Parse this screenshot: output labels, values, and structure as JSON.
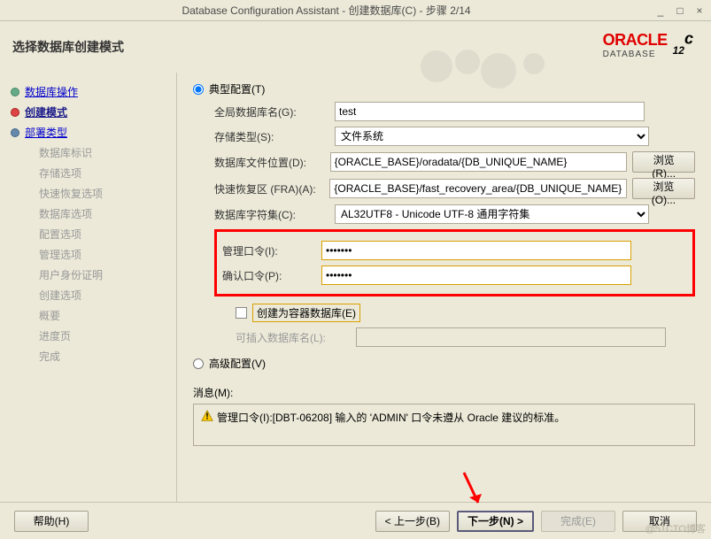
{
  "window": {
    "title": "Database Configuration Assistant - 创建数据库(C) - 步骤 2/14"
  },
  "header": {
    "title": "选择数据库创建模式",
    "brand": "ORACLE",
    "brand_sub": "DATABASE",
    "version": "12",
    "version_sup": "c"
  },
  "sidebar": {
    "items": [
      {
        "label": "数据库操作",
        "state": "done",
        "cls": "step-link"
      },
      {
        "label": "创建模式",
        "state": "current",
        "cls": "step-current"
      },
      {
        "label": "部署类型",
        "state": "future",
        "cls": "step-link"
      },
      {
        "label": "数据库标识",
        "state": "",
        "cls": "step-disabled"
      },
      {
        "label": "存储选项",
        "state": "",
        "cls": "step-disabled"
      },
      {
        "label": "快速恢复选项",
        "state": "",
        "cls": "step-disabled"
      },
      {
        "label": "数据库选项",
        "state": "",
        "cls": "step-disabled"
      },
      {
        "label": "配置选项",
        "state": "",
        "cls": "step-disabled"
      },
      {
        "label": "管理选项",
        "state": "",
        "cls": "step-disabled"
      },
      {
        "label": "用户身份证明",
        "state": "",
        "cls": "step-disabled"
      },
      {
        "label": "创建选项",
        "state": "",
        "cls": "step-disabled"
      },
      {
        "label": "概要",
        "state": "",
        "cls": "step-disabled"
      },
      {
        "label": "进度页",
        "state": "",
        "cls": "step-disabled"
      },
      {
        "label": "完成",
        "state": "",
        "cls": "step-disabled"
      }
    ]
  },
  "form": {
    "radio_typical": "典型配置(T)",
    "radio_advanced": "高级配置(V)",
    "global_db_label": "全局数据库名(G):",
    "global_db_value": "test",
    "storage_type_label": "存储类型(S):",
    "storage_type_value": "文件系统",
    "db_files_label": "数据库文件位置(D):",
    "db_files_value": "{ORACLE_BASE}/oradata/{DB_UNIQUE_NAME}",
    "fra_label": "快速恢复区 (FRA)(A):",
    "fra_value": "{ORACLE_BASE}/fast_recovery_area/{DB_UNIQUE_NAME}",
    "charset_label": "数据库字符集(C):",
    "charset_value": "AL32UTF8 - Unicode UTF-8 通用字符集",
    "admin_pw_label": "管理口令(I):",
    "admin_pw_value": "•••••••",
    "confirm_pw_label": "确认口令(P):",
    "confirm_pw_value": "•••••••",
    "create_cdb_label": "创建为容器数据库(E)",
    "pdb_name_label": "可插入数据库名(L):",
    "pdb_name_value": "",
    "browse_r": "浏览(R)...",
    "browse_o": "浏览(O)...",
    "msg_label": "消息(M):",
    "msg_text": "管理口令(I):[DBT-06208] 输入的 'ADMIN' 口令未遵从 Oracle 建议的标准。"
  },
  "buttons": {
    "help": "帮助(H)",
    "back": "< 上一步(B)",
    "next": "下一步(N) >",
    "finish": "完成(E)",
    "cancel": "取消"
  },
  "watermark": "@51CTO博客"
}
